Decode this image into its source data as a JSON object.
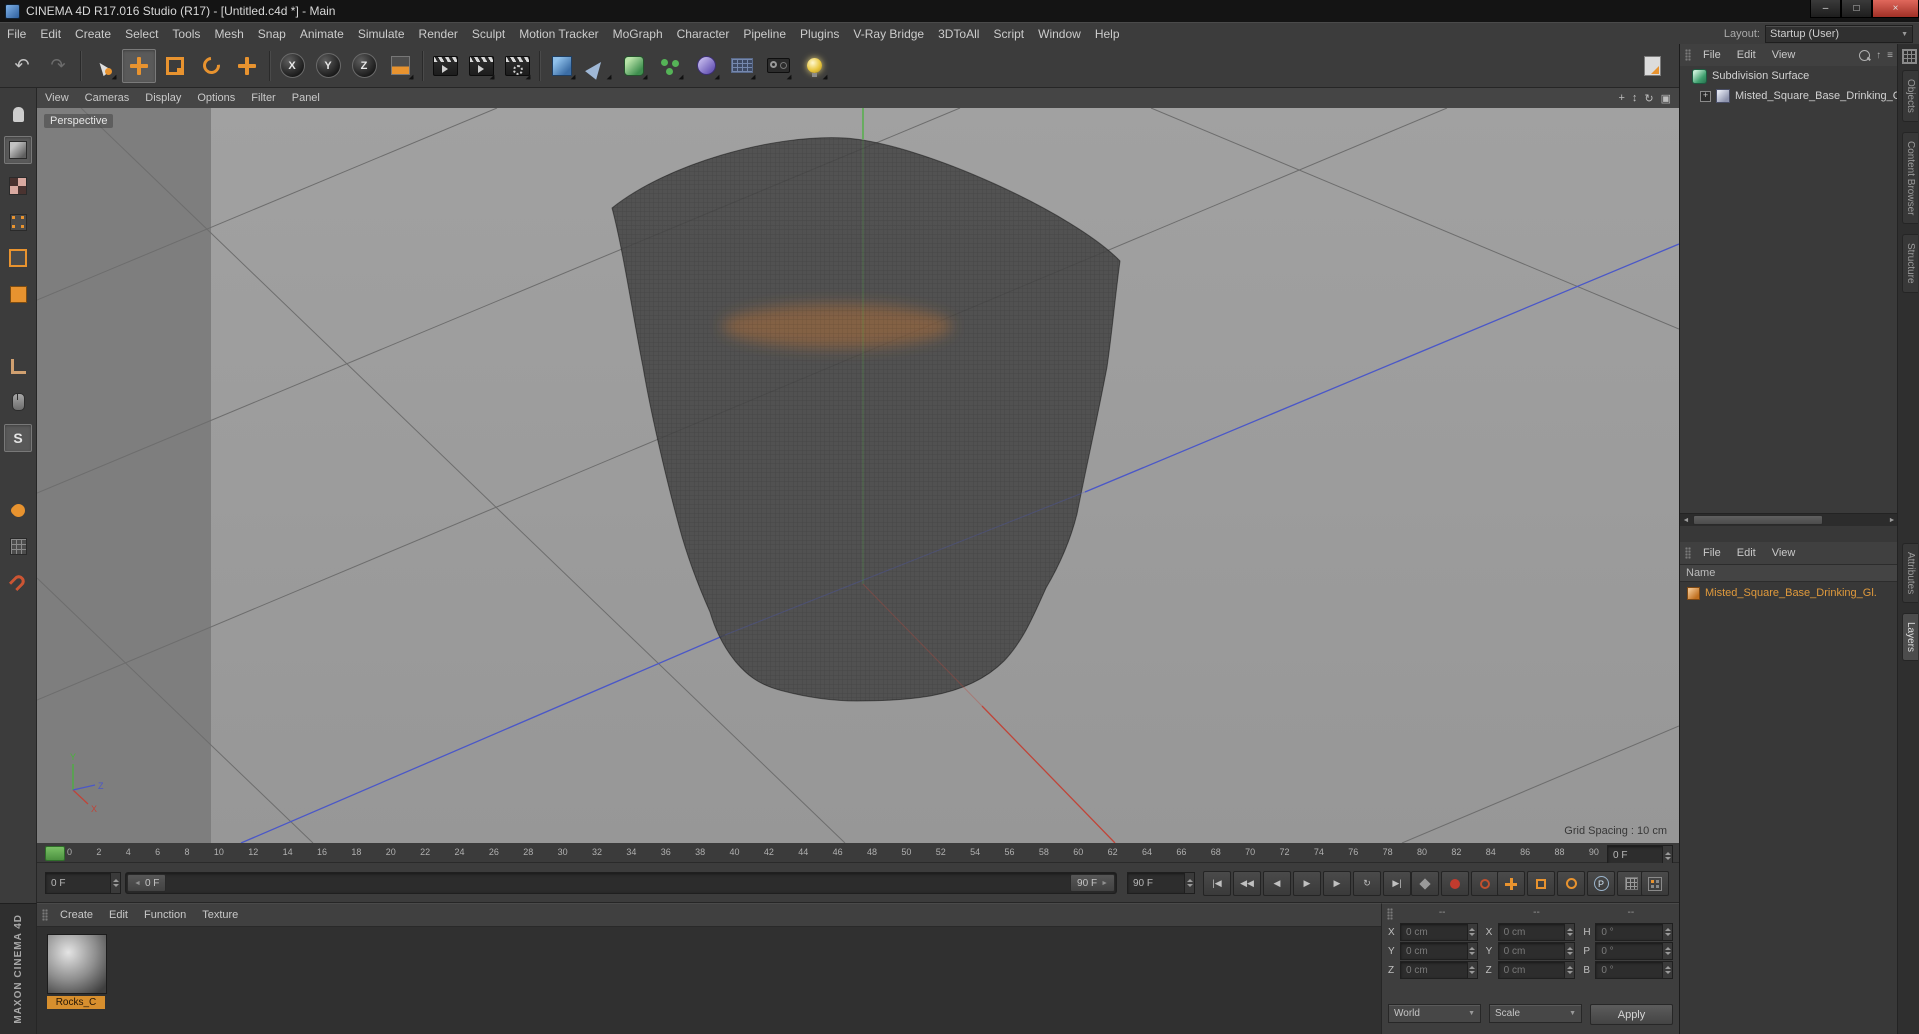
{
  "colors": {
    "accent_orange": "#e8932f",
    "selection_orange": "#e09a3c",
    "axis_x_red": "#c04438",
    "axis_y_green": "#49b33c",
    "axis_z_blue": "#4a57c8",
    "viewport_gray": "#9c9c9c"
  },
  "icons": {
    "minimize": "–",
    "maximize": "□",
    "close": "×",
    "dropdown_arrow": "▼",
    "stepper_up": "▲",
    "stepper_down": "▼",
    "scroll_left": "◄",
    "scroll_right": "►",
    "expand_plus": "+",
    "undo": "↶",
    "redo": "↷",
    "vp_pan": "+",
    "vp_zoom": "↕",
    "vp_rotate": "↻",
    "vp_maximize": "▣",
    "om_up": "↑",
    "om_menu": "≡"
  },
  "window": {
    "title": "CINEMA 4D R17.016 Studio (R17) - [Untitled.c4d *] - Main"
  },
  "menubar": {
    "items": [
      "File",
      "Edit",
      "Create",
      "Select",
      "Tools",
      "Mesh",
      "Snap",
      "Animate",
      "Simulate",
      "Render",
      "Sculpt",
      "Motion Tracker",
      "MoGraph",
      "Character",
      "Pipeline",
      "Plugins",
      "V-Ray Bridge",
      "3DToAll",
      "Script",
      "Window",
      "Help"
    ],
    "layout_label": "Layout:",
    "layout_value": "Startup (User)"
  },
  "toolbar": {
    "axis_x": "X",
    "axis_y": "Y",
    "axis_z": "Z"
  },
  "left_toolbar": {
    "snap_letter": "S"
  },
  "viewport": {
    "menu": [
      "View",
      "Cameras",
      "Display",
      "Options",
      "Filter",
      "Panel"
    ],
    "camera_label": "Perspective",
    "grid_spacing": "Grid Spacing : 10 cm",
    "axis": {
      "x": "X",
      "y": "Y",
      "z": "Z"
    }
  },
  "object_manager": {
    "menu": [
      "File",
      "Edit",
      "View"
    ],
    "items": [
      {
        "label": "Subdivision Surface"
      },
      {
        "label": "Misted_Square_Base_Drinking_G"
      }
    ]
  },
  "layer_panel": {
    "menu": [
      "File",
      "Edit",
      "View"
    ],
    "name_header": "Name",
    "item": "Misted_Square_Base_Drinking_Gl."
  },
  "side_tabs": {
    "top": [
      "Objects",
      "Content Browser",
      "Structure"
    ],
    "bottom": [
      "Attributes",
      "Layers"
    ]
  },
  "timeline": {
    "ticks": [
      "0",
      "2",
      "4",
      "6",
      "8",
      "10",
      "12",
      "14",
      "16",
      "18",
      "20",
      "22",
      "24",
      "26",
      "28",
      "30",
      "32",
      "34",
      "36",
      "38",
      "40",
      "42",
      "44",
      "46",
      "48",
      "50",
      "52",
      "54",
      "56",
      "58",
      "60",
      "62",
      "64",
      "66",
      "68",
      "70",
      "72",
      "74",
      "76",
      "78",
      "80",
      "82",
      "84",
      "86",
      "88",
      "90"
    ],
    "frame_display": "0 F"
  },
  "transport": {
    "current_frame": "0 F",
    "range_start": "0 F",
    "range_end": "90 F",
    "max_frame": "90 F",
    "buttons": [
      {
        "name": "goto-start-button",
        "glyph": "|◀"
      },
      {
        "name": "previous-key-button",
        "glyph": "◀◀"
      },
      {
        "name": "previous-frame-button",
        "glyph": "◀"
      },
      {
        "name": "play-button",
        "glyph": "▶"
      },
      {
        "name": "next-frame-button",
        "glyph": "▶"
      },
      {
        "name": "loop-button",
        "glyph": "↻"
      },
      {
        "name": "goto-end-button",
        "glyph": "▶|"
      }
    ],
    "parameter_letter": "P"
  },
  "material_manager": {
    "menu": [
      "Create",
      "Edit",
      "Function",
      "Texture"
    ],
    "materials": [
      {
        "name": "Rocks_C"
      }
    ]
  },
  "coordinates": {
    "headers": [
      "--",
      "--",
      "--"
    ],
    "position": {
      "labels": [
        "X",
        "Y",
        "Z"
      ],
      "values": [
        "0 cm",
        "0 cm",
        "0 cm"
      ]
    },
    "size": {
      "labels": [
        "X",
        "Y",
        "Z"
      ],
      "values": [
        "0 cm",
        "0 cm",
        "0 cm"
      ]
    },
    "rotation": {
      "labels": [
        "H",
        "P",
        "B"
      ],
      "values": [
        "0 °",
        "0 °",
        "0 °"
      ]
    },
    "system_dropdown": "World",
    "mode_dropdown": "Scale",
    "apply_label": "Apply"
  },
  "branding": {
    "text": "MAXON CINEMA 4D"
  }
}
